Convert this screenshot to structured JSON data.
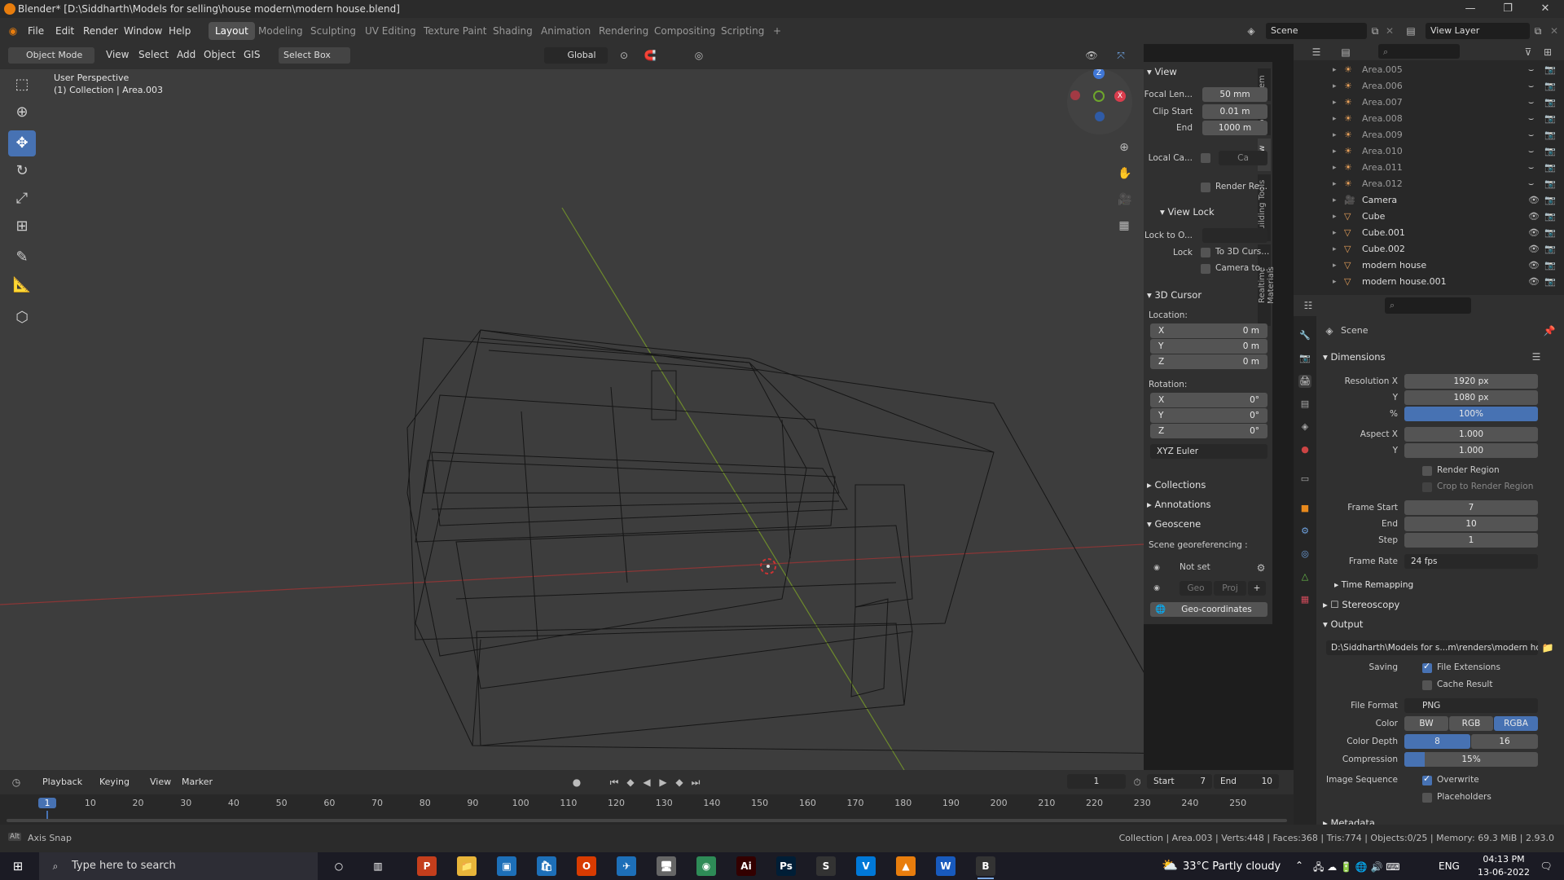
{
  "window": {
    "title": "Blender* [D:\\Siddharth\\Models for selling\\house modern\\modern house.blend]",
    "minimize": "—",
    "maximize": "❐",
    "close": "✕"
  },
  "menubar": {
    "items": [
      "File",
      "Edit",
      "Render",
      "Window",
      "Help"
    ]
  },
  "workspaces": {
    "tabs": [
      "Layout",
      "Modeling",
      "Sculpting",
      "UV Editing",
      "Texture Paint",
      "Shading",
      "Animation",
      "Rendering",
      "Compositing",
      "Scripting"
    ],
    "active": "Layout",
    "add": "+"
  },
  "scene": {
    "name": "Scene",
    "view_layer": "View Layer"
  },
  "viewport_header": {
    "mode": "Object Mode",
    "menus": [
      "View",
      "Select",
      "Add",
      "Object",
      "GIS"
    ],
    "select_box": "Select Box",
    "orientation": "Global"
  },
  "viewport": {
    "perspective": "User Perspective",
    "collection": "(1) Collection | Area.003"
  },
  "npanel": {
    "tabs": [
      "Item",
      "Tool",
      "View",
      "Building Tools",
      "Realtime Materials"
    ],
    "active_tab": "View",
    "view": {
      "header": "View",
      "focal_label": "Focal Len...",
      "focal": "50 mm",
      "clip_start_label": "Clip Start",
      "clip_start": "0.01 m",
      "end_label": "End",
      "end": "1000 m",
      "local_cam_label": "Local Ca...",
      "local_cam_value": "Ca",
      "render_region": "Render Re..."
    },
    "view_lock": {
      "header": "View Lock",
      "lock_to_label": "Lock to O...",
      "lock_label": "Lock",
      "to_3d_cursor": "To 3D Curs...",
      "camera_to": "Camera to ..."
    },
    "cursor": {
      "header": "3D Cursor",
      "location_label": "Location:",
      "loc_x": "0 m",
      "loc_y": "0 m",
      "loc_z": "0 m",
      "rotation_label": "Rotation:",
      "rot_x": "0°",
      "rot_y": "0°",
      "rot_z": "0°",
      "rotation_mode": "XYZ Euler",
      "x": "X",
      "y": "Y",
      "z": "Z"
    },
    "collections": "Collections",
    "annotations": "Annotations",
    "geoscene": {
      "header": "Geoscene",
      "georef_label": "Scene georeferencing :",
      "not_set": "Not set",
      "geo": "Geo",
      "proj": "Proj",
      "plus": "+",
      "geo_coords": "Geo-coordinates"
    }
  },
  "outliner": {
    "rows": [
      {
        "name": "Area.005",
        "type": "light"
      },
      {
        "name": "Area.006",
        "type": "light"
      },
      {
        "name": "Area.007",
        "type": "light"
      },
      {
        "name": "Area.008",
        "type": "light"
      },
      {
        "name": "Area.009",
        "type": "light"
      },
      {
        "name": "Area.010",
        "type": "light"
      },
      {
        "name": "Area.011",
        "type": "light"
      },
      {
        "name": "Area.012",
        "type": "light"
      },
      {
        "name": "Camera",
        "type": "camera"
      },
      {
        "name": "Cube",
        "type": "mesh"
      },
      {
        "name": "Cube.001",
        "type": "mesh"
      },
      {
        "name": "Cube.002",
        "type": "mesh"
      },
      {
        "name": "modern house",
        "type": "mesh"
      },
      {
        "name": "modern house.001",
        "type": "mesh"
      }
    ]
  },
  "properties": {
    "context": "Scene",
    "dimensions": {
      "header": "Dimensions",
      "res_x_label": "Resolution X",
      "res_x": "1920 px",
      "res_y_label": "Y",
      "res_y": "1080 px",
      "pct_label": "%",
      "pct": "100%",
      "aspect_x_label": "Aspect X",
      "aspect_x": "1.000",
      "aspect_y_label": "Y",
      "aspect_y": "1.000",
      "render_region": "Render Region",
      "crop": "Crop to Render Region",
      "frame_start_label": "Frame Start",
      "frame_start": "7",
      "frame_end_label": "End",
      "frame_end": "10",
      "step_label": "Step",
      "step": "1",
      "frame_rate_label": "Frame Rate",
      "frame_rate": "24 fps",
      "time_remap": "Time Remapping"
    },
    "stereoscopy": "Stereoscopy",
    "output": {
      "header": "Output",
      "path": "D:\\Siddharth\\Models for s...m\\renders\\modern house",
      "saving_label": "Saving",
      "file_ext": "File Extensions",
      "cache": "Cache Result",
      "format_label": "File Format",
      "format": "PNG",
      "color_label": "Color",
      "color_opts": [
        "BW",
        "RGB",
        "RGBA"
      ],
      "color_active": "RGBA",
      "depth_label": "Color Depth",
      "depth_opts": [
        "8",
        "16"
      ],
      "compression_label": "Compression",
      "compression": "15%",
      "compression_level": 0.15,
      "seq_label": "Image Sequence",
      "overwrite": "Overwrite",
      "placeholders": "Placeholders"
    },
    "metadata": "Metadata"
  },
  "timeline": {
    "menus": [
      "Playback",
      "Keying",
      "View",
      "Marker"
    ],
    "current_frame": "1",
    "start_label": "Start",
    "start": "7",
    "end_label": "End",
    "end": "10",
    "ticks": [
      "1",
      "10",
      "20",
      "30",
      "40",
      "50",
      "60",
      "70",
      "80",
      "90",
      "100",
      "110",
      "120",
      "130",
      "140",
      "150",
      "160",
      "170",
      "180",
      "190",
      "200",
      "210",
      "220",
      "230",
      "240",
      "250"
    ]
  },
  "statusbar": {
    "left": "Axis Snap",
    "key": "Alt",
    "right": "Collection | Area.003 | Verts:448 | Faces:368 | Tris:774 | Objects:0/25 | Memory: 69.3 MiB | 2.93.0"
  },
  "taskbar": {
    "search_placeholder": "Type here to search",
    "weather": "33°C  Partly cloudy",
    "lang": "ENG",
    "time": "04:13 PM",
    "date": "13-06-2022",
    "apps": [
      "P",
      "📁",
      "▣",
      "🛍",
      "O",
      "✈",
      "🖥",
      "◉",
      "Ai",
      "Ps",
      "S",
      "V",
      "▲",
      "W",
      "B"
    ]
  }
}
